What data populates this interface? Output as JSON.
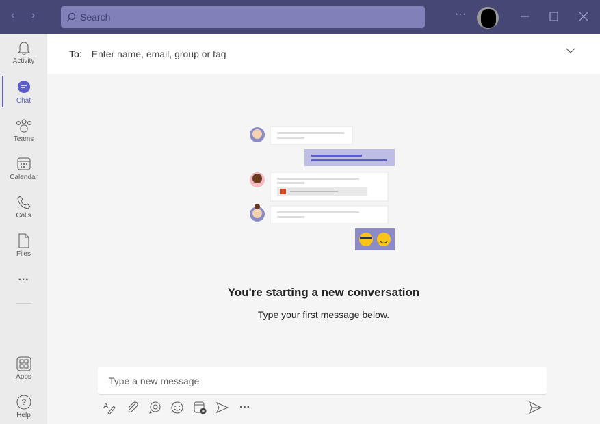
{
  "search": {
    "placeholder": "Search"
  },
  "titlebar": {
    "more": "···"
  },
  "rail": [
    {
      "label": "Activity"
    },
    {
      "label": "Chat"
    },
    {
      "label": "Teams"
    },
    {
      "label": "Calendar"
    },
    {
      "label": "Calls"
    },
    {
      "label": "Files"
    },
    {
      "label": "Apps"
    },
    {
      "label": "Help"
    }
  ],
  "rail_more": "···",
  "to": {
    "label": "To:",
    "placeholder": "Enter name, email, group or tag"
  },
  "main": {
    "title": "You're starting a new conversation",
    "subtitle": "Type your first message below."
  },
  "compose": {
    "placeholder": "Type a new message"
  },
  "colors": {
    "brand": "#464775",
    "accent": "#5b5fc7"
  }
}
